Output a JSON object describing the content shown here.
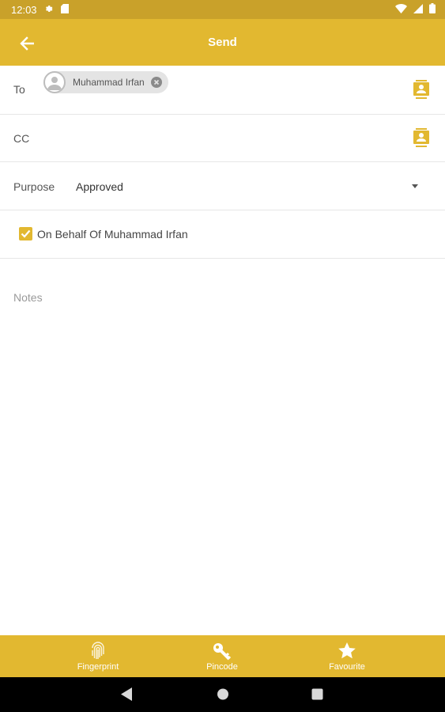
{
  "status_bar": {
    "time": "12:03"
  },
  "app_bar": {
    "title": "Send"
  },
  "to": {
    "label": "To",
    "chip_name": "Muhammad Irfan"
  },
  "cc": {
    "label": "CC"
  },
  "purpose": {
    "label": "Purpose",
    "value": "Approved"
  },
  "on_behalf": {
    "label": "On Behalf Of Muhammad Irfan",
    "checked": true
  },
  "notes": {
    "placeholder": "Notes"
  },
  "bottom_nav": {
    "items": [
      {
        "label": "Fingerprint",
        "icon": "fingerprint-icon"
      },
      {
        "label": "Pincode",
        "icon": "key-icon"
      },
      {
        "label": "Favourite",
        "icon": "star-icon"
      }
    ]
  },
  "colors": {
    "accent": "#e2b830",
    "status_bar": "#c9a12a"
  }
}
